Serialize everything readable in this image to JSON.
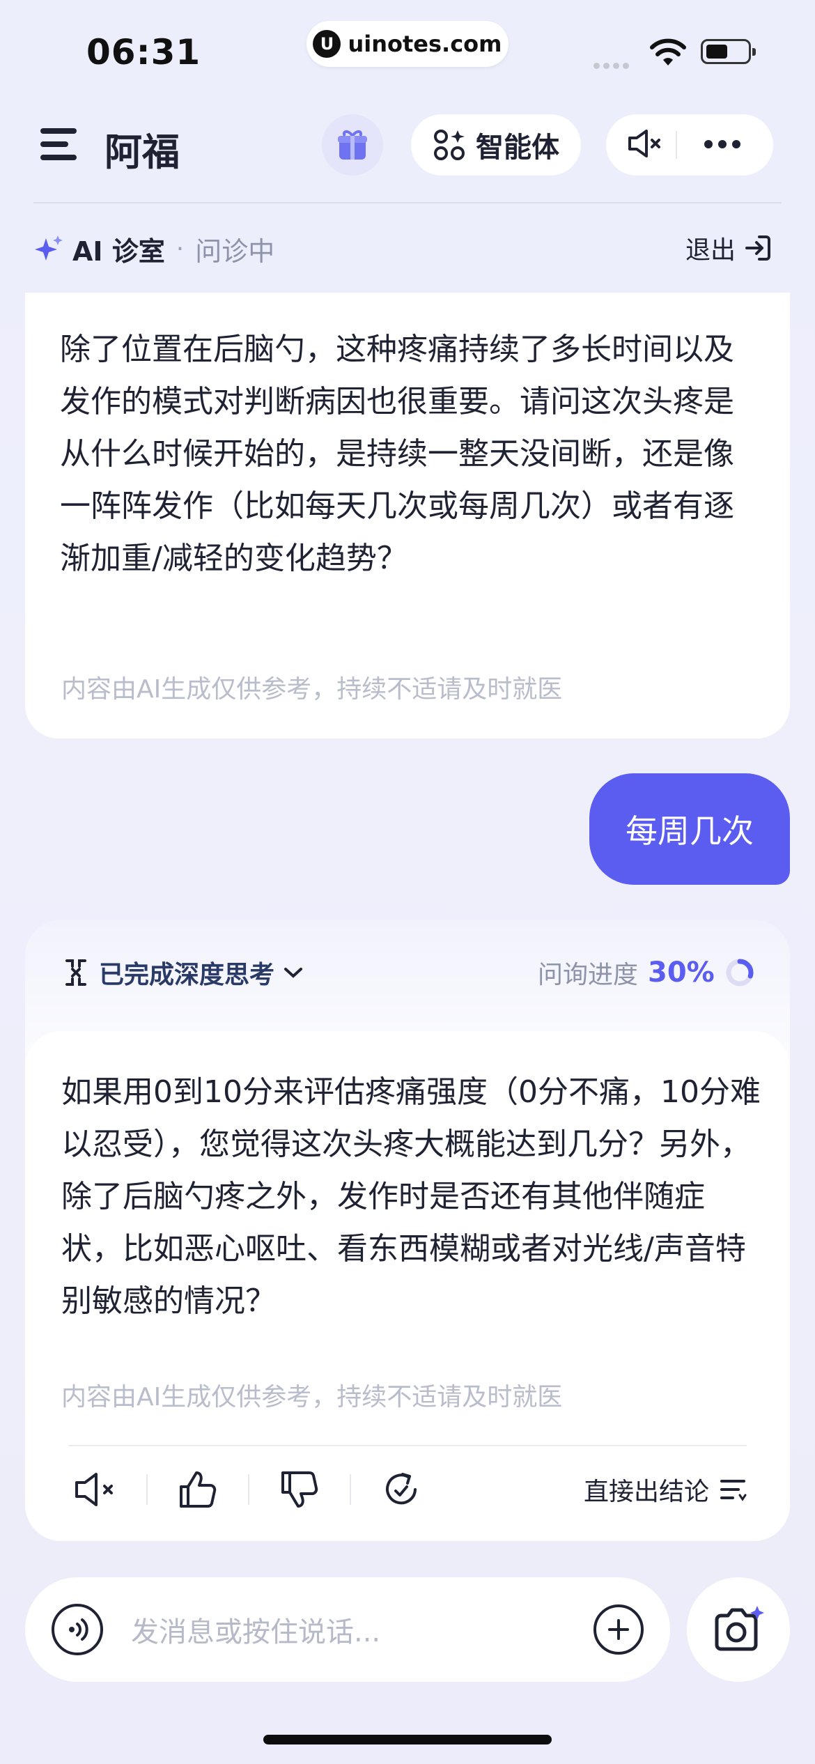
{
  "status_bar": {
    "time": "06:31",
    "url": "uinotes.com"
  },
  "nav": {
    "title": "阿福",
    "agent_label": "智能体",
    "icons": [
      "menu-icon",
      "gift-icon",
      "agent-grid-icon",
      "speaker-mute-icon",
      "more-icon"
    ]
  },
  "room": {
    "title": "AI 诊室",
    "separator": "·",
    "status": "问诊中",
    "exit_label": "退出"
  },
  "messages": [
    {
      "role": "assistant",
      "text": "除了位置在后脑勺，这种疼痛持续了多长时间以及发作的模式对判断病因也很重要。请问这次头疼是从什么时候开始的，是持续一整天没间断，还是像一阵阵发作（比如每天几次或每周几次）或者有逐渐加重/减轻的变化趋势？",
      "disclaimer": "内容由AI生成仅供参考，持续不适请及时就医"
    },
    {
      "role": "user",
      "text": "每周几次"
    },
    {
      "role": "assistant",
      "thinking_label": "已完成深度思考",
      "progress_label": "问询进度",
      "progress_value": "30%",
      "progress_fraction": 0.3,
      "text": "如果用0到10分来评估疼痛强度（0分不痛，10分难以忍受），您觉得这次头疼大概能达到几分？另外，除了后脑勺疼之外，发作时是否还有其他伴随症状，比如恶心呕吐、看东西模糊或者对光线/声音特别敏感的情况？",
      "disclaimer": "内容由AI生成仅供参考，持续不适请及时就医",
      "conclude_label": "直接出结论"
    }
  ],
  "input": {
    "placeholder": "发消息或按住说话..."
  },
  "colors": {
    "accent": "#5b5cf0",
    "text": "#1f2233",
    "muted": "#b8bccb"
  }
}
